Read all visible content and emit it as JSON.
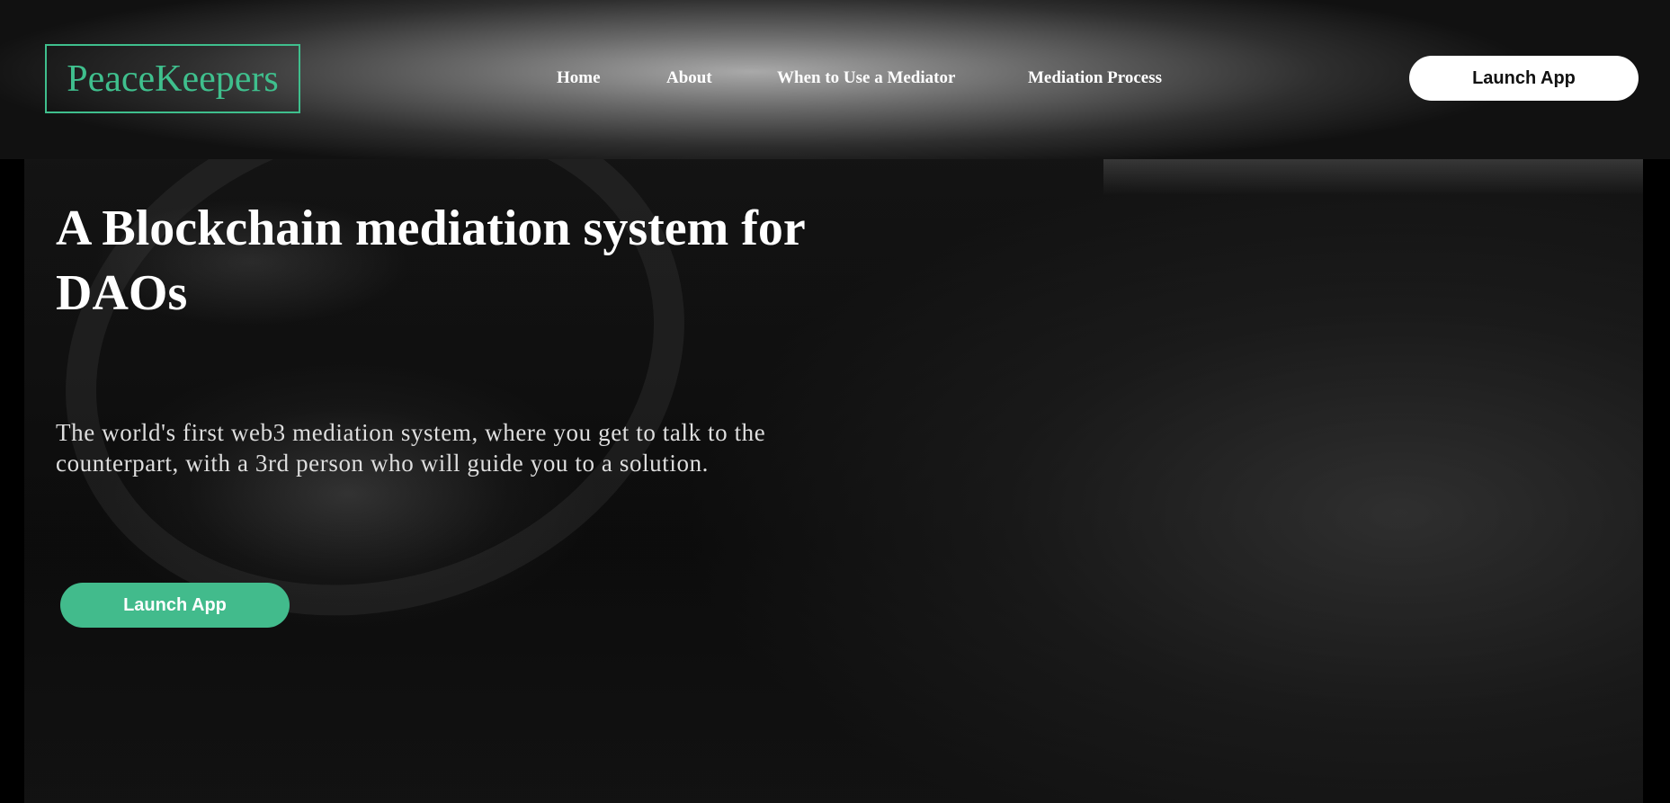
{
  "header": {
    "logo_text": "PeaceKeepers",
    "nav": {
      "home": "Home",
      "about": "About",
      "when": "When to Use a Mediator",
      "process": "Mediation Process"
    },
    "launch_label": "Launch App"
  },
  "hero": {
    "title": "A Blockchain mediation system for DAOs",
    "subtitle": "The world's first web3 mediation system, where you get to talk to the counterpart, with a 3rd person who will guide you to a solution.",
    "launch_label": "Launch App"
  },
  "colors": {
    "accent": "#42bb8c",
    "background": "#000000",
    "text": "#ffffff"
  }
}
